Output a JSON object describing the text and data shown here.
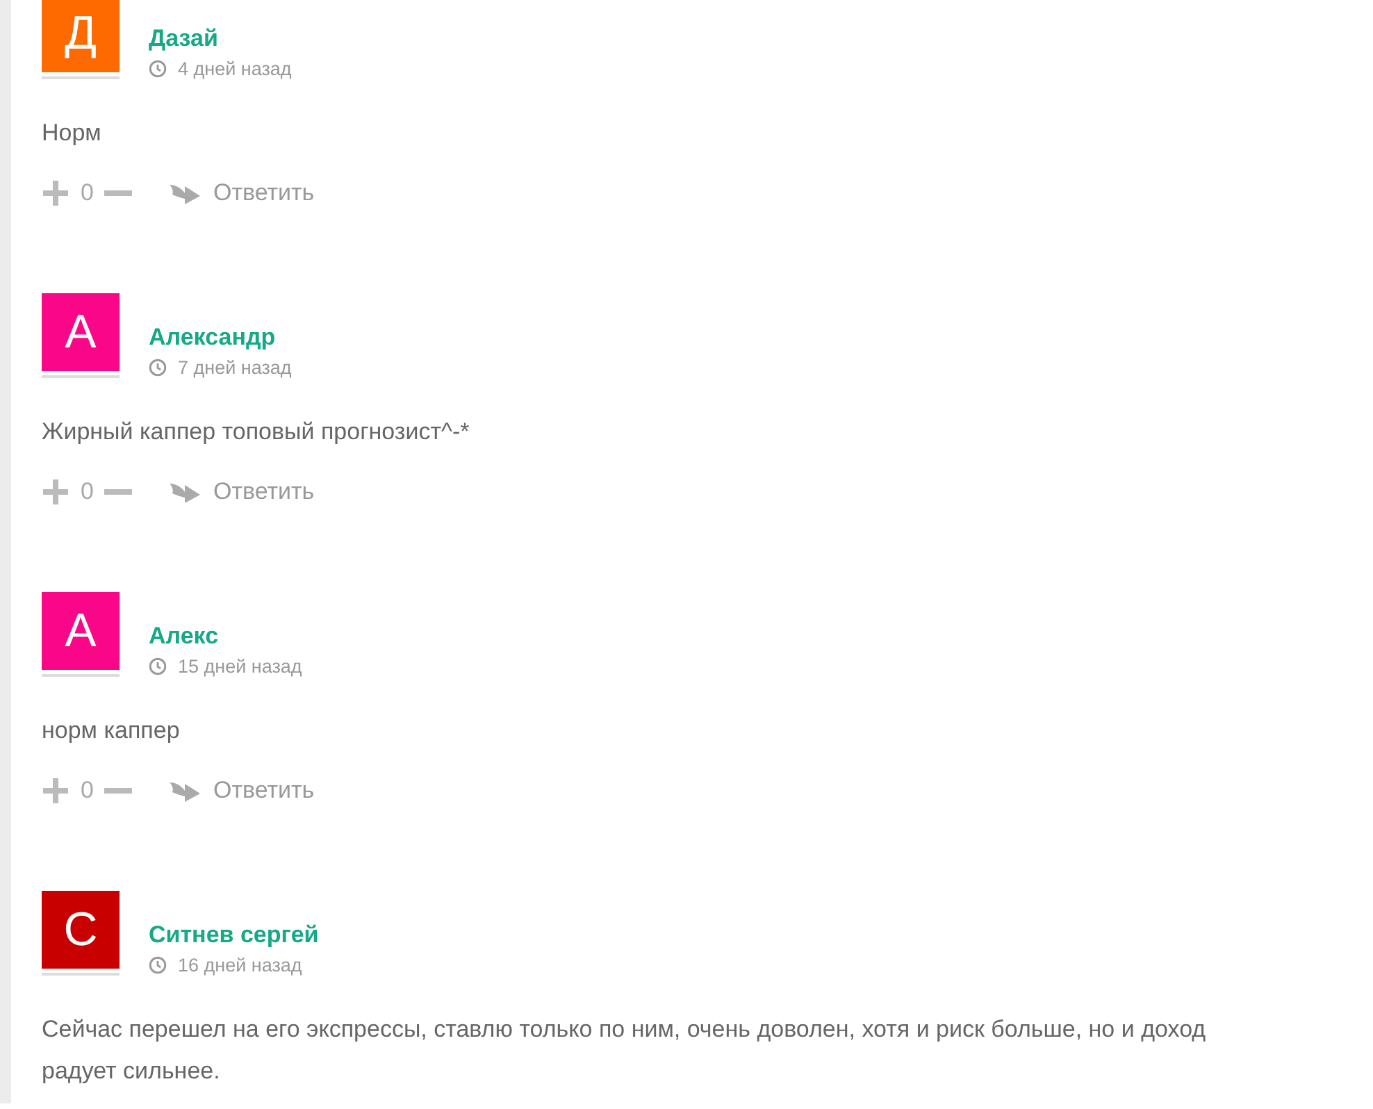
{
  "comments": [
    {
      "avatar_letter": "Д",
      "color": "#ff6a00",
      "author": "Дазай",
      "time": "4 дней назад",
      "text": "Норм",
      "score": "0",
      "reply": "Ответить"
    },
    {
      "avatar_letter": "А",
      "color": "#fa0688",
      "author": "Александр",
      "time": "7 дней назад",
      "text": "Жирный каппер топовый прогнозист^-*",
      "score": "0",
      "reply": "Ответить"
    },
    {
      "avatar_letter": "А",
      "color": "#fa0688",
      "author": "Алекс",
      "time": "15 дней назад",
      "text": "норм каппер",
      "score": "0",
      "reply": "Ответить"
    },
    {
      "avatar_letter": "С",
      "color": "#c80000",
      "author": "Ситнев сергей",
      "time": "16 дней назад",
      "text": "Сейчас перешел на его экспрессы, ставлю только по ним, очень доволен, хотя и риск больше, но и доход радует сильнее."
    }
  ]
}
